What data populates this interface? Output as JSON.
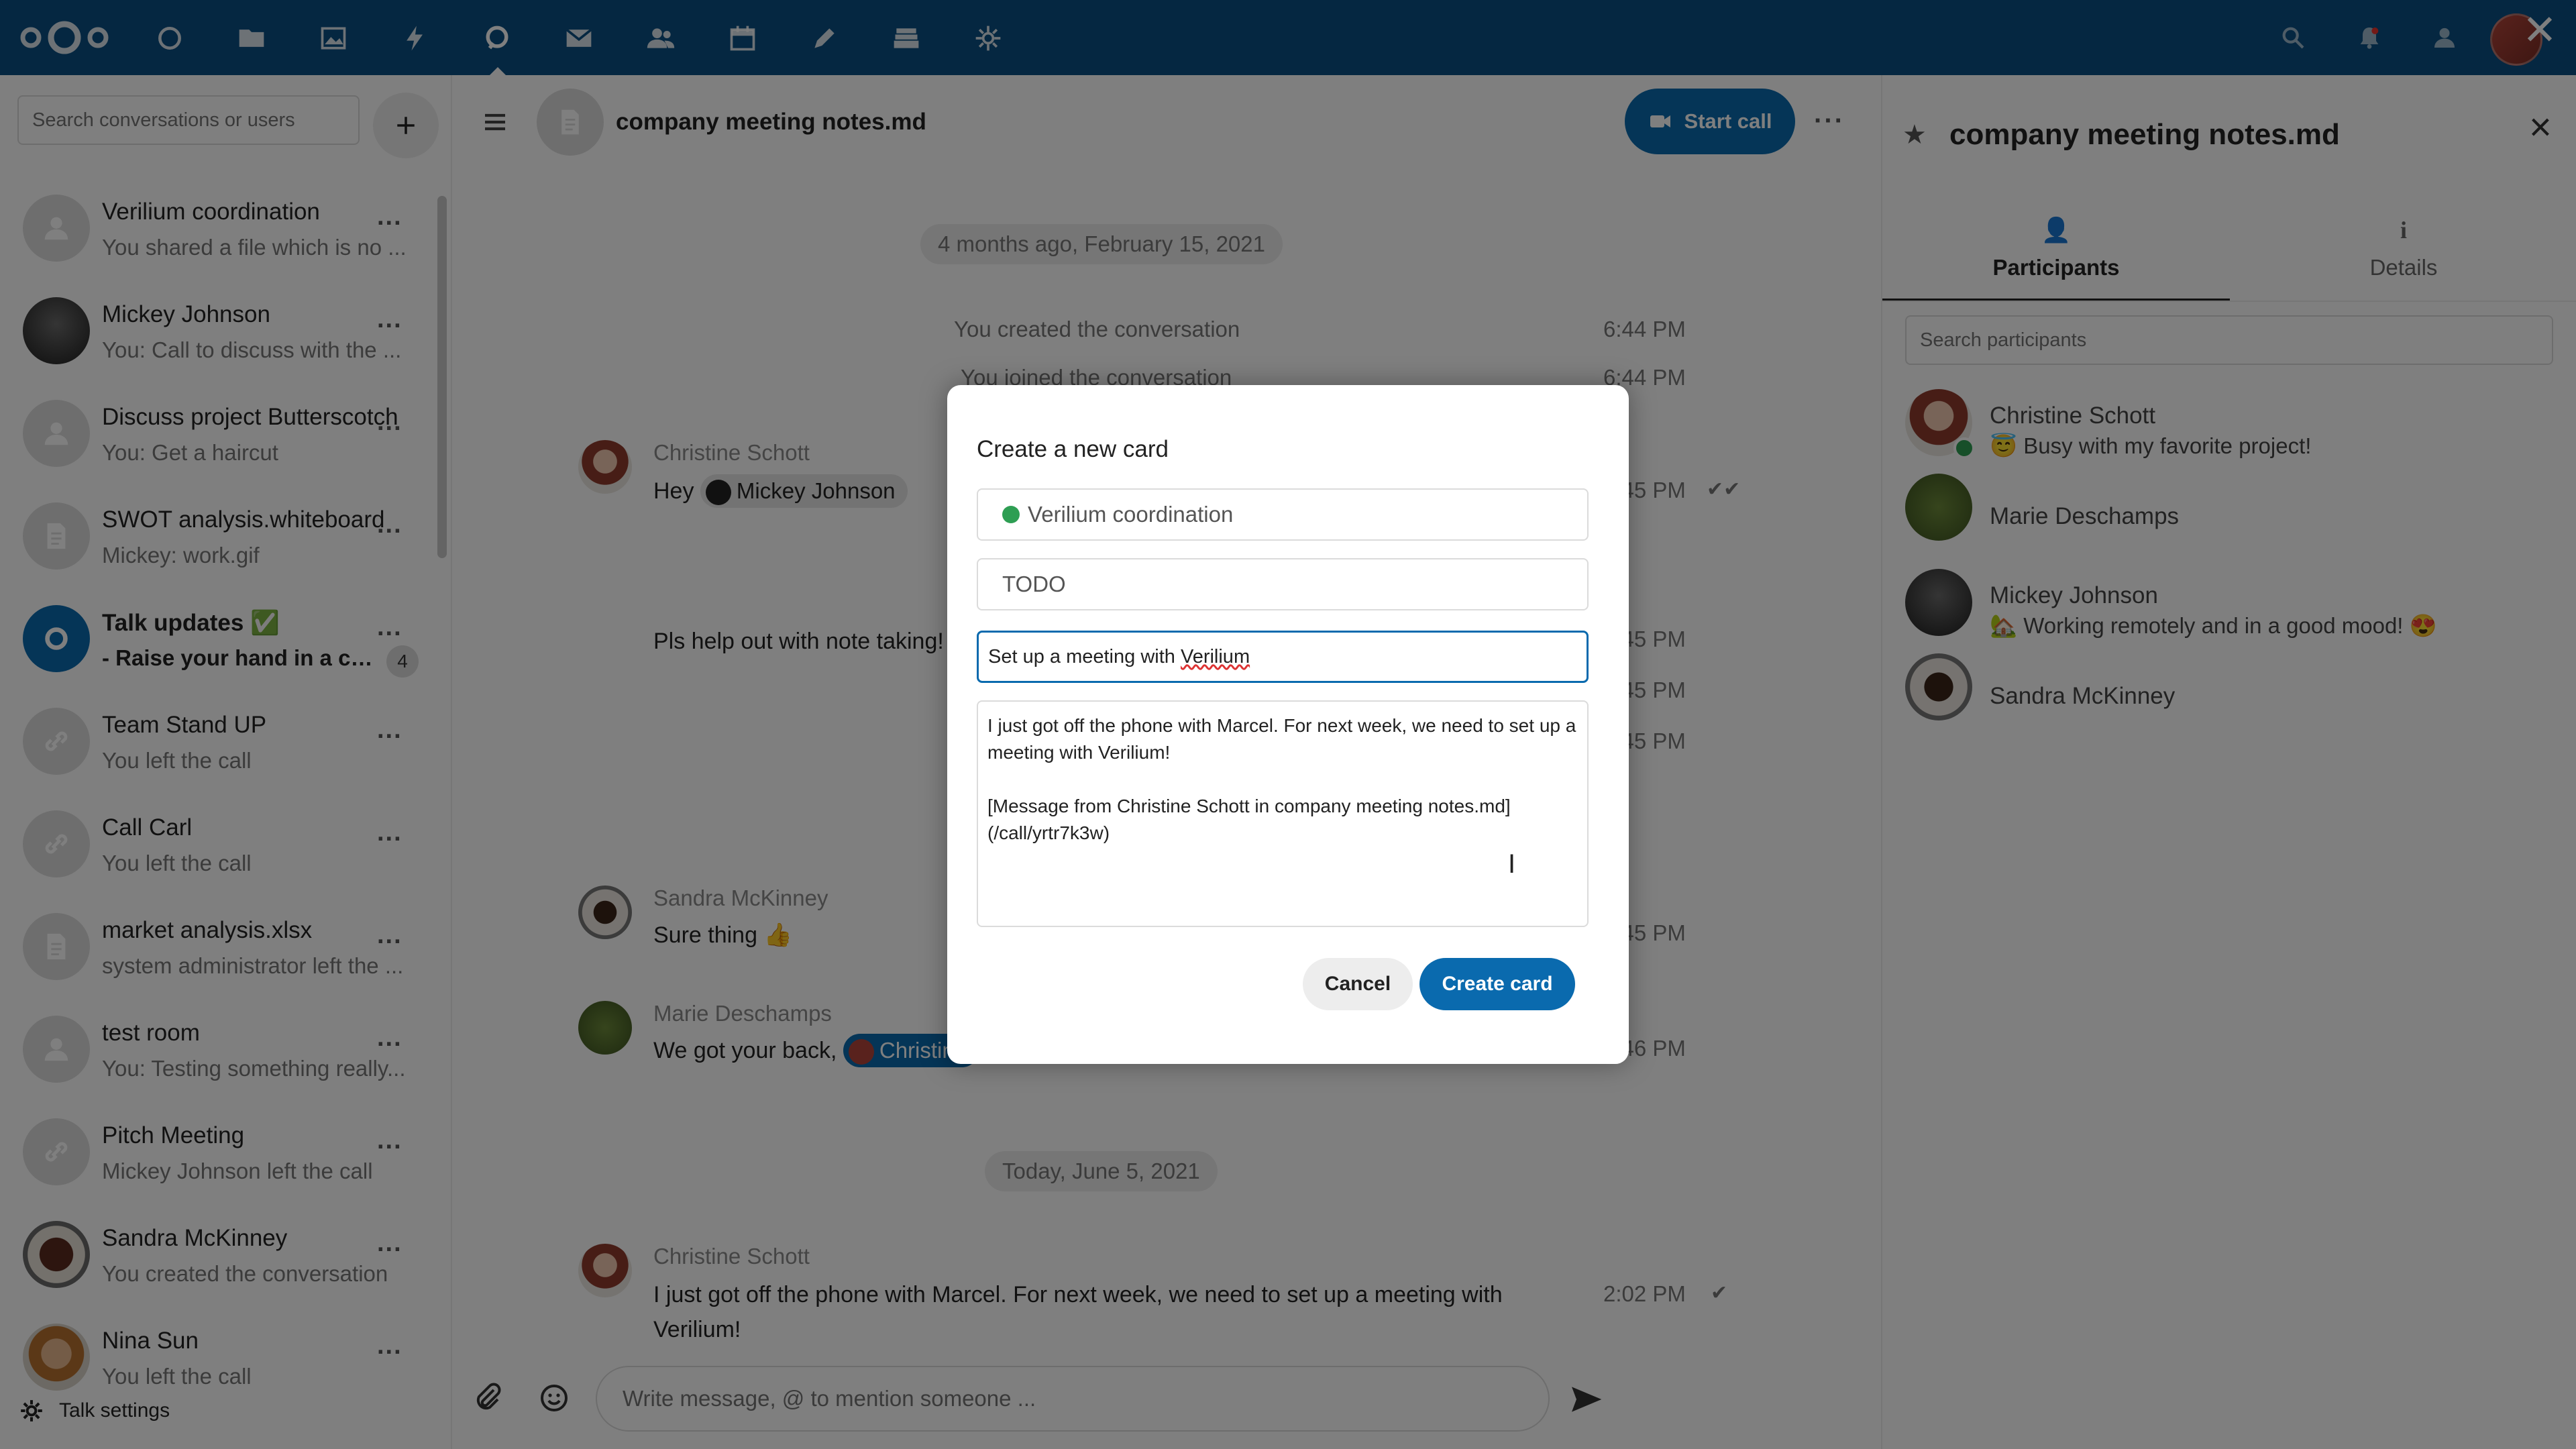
{
  "topbar": {
    "apps": [
      "dashboard-icon",
      "files-icon",
      "photos-icon",
      "activity-icon",
      "talk-icon",
      "mail-icon",
      "contacts-icon",
      "calendar-icon",
      "notes-icon",
      "deck-icon",
      "settings-icon"
    ]
  },
  "sidebar": {
    "search_placeholder": "Search conversations or users",
    "conversations": [
      {
        "title": "Verilium coordination",
        "subtitle": "You shared a file which is no ...",
        "avatar": "group"
      },
      {
        "title": "Mickey Johnson",
        "subtitle": "You: Call to discuss with the ...",
        "avatar": "photo-mickey"
      },
      {
        "title": "Discuss project Butterscotch",
        "subtitle": "You: Get a haircut",
        "avatar": "group"
      },
      {
        "title": "SWOT analysis.whiteboard",
        "subtitle": "Mickey: work.gif",
        "avatar": "file"
      },
      {
        "title": "Talk updates ✅",
        "subtitle": "- Raise your hand in a ca...",
        "avatar": "talk",
        "badge": "4",
        "unread": true
      },
      {
        "title": "Team Stand UP",
        "subtitle": "You left the call",
        "avatar": "link"
      },
      {
        "title": "Call Carl",
        "subtitle": "You left the call",
        "avatar": "link"
      },
      {
        "title": "market analysis.xlsx",
        "subtitle": "system administrator left the ...",
        "avatar": "file"
      },
      {
        "title": "test room",
        "subtitle": "You: Testing something really...",
        "avatar": "group"
      },
      {
        "title": "Pitch Meeting",
        "subtitle": "Mickey Johnson left the call",
        "avatar": "link"
      },
      {
        "title": "Sandra McKinney",
        "subtitle": "You created the conversation",
        "avatar": "photo-sandra"
      },
      {
        "title": "Nina Sun",
        "subtitle": "You left the call",
        "avatar": "photo-nina"
      }
    ],
    "more_label": "...",
    "settings_label": "Talk settings"
  },
  "chat": {
    "title": "company meeting notes.md",
    "start_call": "Start call",
    "more": "···",
    "date1": "4 months ago, February 15, 2021",
    "sys1": "You created the conversation",
    "sys1_time": "6:44 PM",
    "sys2": "You joined the conversation",
    "sys2_time": "6:44 PM",
    "msg1_author": "Christine Schott",
    "msg1_prefix": "Hey",
    "msg1_mention": "Mickey Johnson",
    "msg1_time": "6:45 PM",
    "msg1_line2": "Pls help out with note taking!",
    "sys3_time": "6:45 PM",
    "sys4_time": "6:45 PM",
    "sys5_time": "6:45 PM",
    "msg2_author": "Sandra McKinney",
    "msg2_text": "Sure thing 👍",
    "msg2_time": "6:45 PM",
    "msg3_author": "Marie Deschamps",
    "msg3_text": "We got your back,",
    "msg3_mention": "Christine",
    "msg3_time": "6:46 PM",
    "date2": "Today, June 5, 2021",
    "msg4_author": "Christine Schott",
    "msg4_text": "I just got off the phone with Marcel. For next week, we need to set up a meeting with Verilium!",
    "msg4_time": "2:02 PM",
    "composer_placeholder": "Write message, @ to mention someone ..."
  },
  "right_panel": {
    "title": "company meeting notes.md",
    "tab_participants": "Participants",
    "tab_details": "Details",
    "search_placeholder": "Search participants",
    "participants": [
      {
        "name": "Christine Schott",
        "status": "😇 Busy with my favorite project!"
      },
      {
        "name": "Marie Deschamps",
        "status": ""
      },
      {
        "name": "Mickey Johnson",
        "status": "🏡 Working remotely and in a good mood! 😍"
      },
      {
        "name": "Sandra McKinney",
        "status": ""
      }
    ]
  },
  "modal": {
    "title": "Create a new card",
    "board": "Verilium coordination",
    "stack": "TODO",
    "card_title_prefix": "Set up a meeting with ",
    "card_title_word": "Verilium",
    "description": "I just got off the phone with Marcel. For next week, we need to set up a meeting with Verilium!\n\n[Message from Christine Schott in company meeting notes.md]\n(/call/yrtr7k3w)",
    "cancel": "Cancel",
    "create": "Create card"
  },
  "colors": {
    "header": "#0a4f82",
    "primary": "#0a6aae",
    "online": "#2e9e53"
  }
}
